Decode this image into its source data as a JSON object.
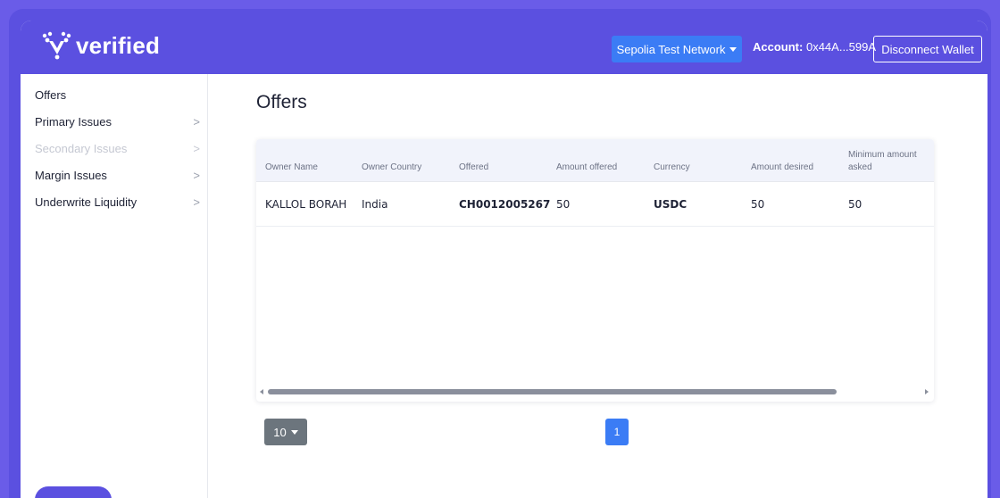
{
  "brand": {
    "name": "verified",
    "accent": "#5b50e0"
  },
  "header": {
    "network_label": "Sepolia Test Network",
    "account_label": "Account:",
    "account_value": "0x44A...599A",
    "disconnect_label": "Disconnect Wallet"
  },
  "sidebar": {
    "items": [
      {
        "label": "Offers",
        "has_chevron": false,
        "disabled": false
      },
      {
        "label": "Primary Issues",
        "has_chevron": true,
        "disabled": false
      },
      {
        "label": "Secondary Issues",
        "has_chevron": true,
        "disabled": true
      },
      {
        "label": "Margin Issues",
        "has_chevron": true,
        "disabled": false
      },
      {
        "label": "Underwrite Liquidity",
        "has_chevron": true,
        "disabled": false
      }
    ],
    "chevron": ">"
  },
  "main": {
    "title": "Offers",
    "table": {
      "columns": [
        "Owner Name",
        "Owner Country",
        "Offered",
        "Amount offered",
        "Currency",
        "Amount desired",
        "Minimum amount asked"
      ],
      "rows": [
        [
          "KALLOL BORAH",
          "India",
          "CH0012005267",
          "50",
          "USDC",
          "50",
          "50"
        ]
      ]
    },
    "pagination": {
      "page_size": "10",
      "current_page": "1"
    }
  }
}
